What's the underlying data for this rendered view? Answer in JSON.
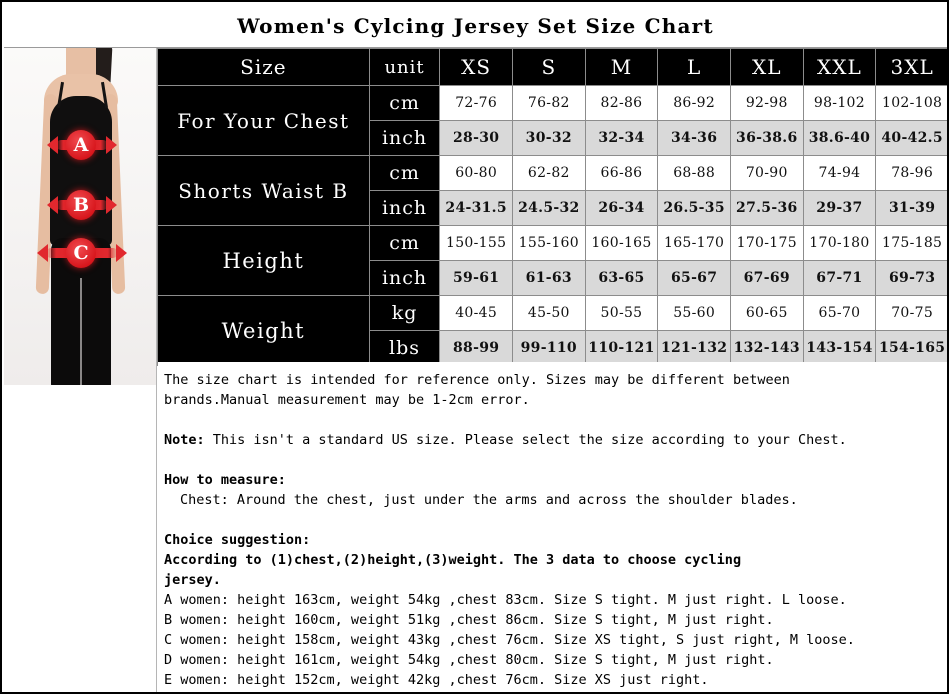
{
  "title": "Women's Cylcing Jersey Set Size Chart",
  "model_photo": {
    "alt": "woman wearing black camisole and leggings with measurement arrows",
    "markers": [
      {
        "id": "A",
        "meaning": "chest"
      },
      {
        "id": "B",
        "meaning": "waist"
      },
      {
        "id": "C",
        "meaning": "hips"
      }
    ]
  },
  "colors": {
    "header_bg": "#000000",
    "header_fg": "#ffffff",
    "row_alt_bg": "#d9d9d9",
    "row_bg": "#ffffff",
    "arrow_red": "#e1282e",
    "border": "#8c8c8c"
  },
  "table": {
    "corner_label": "Size",
    "unit_label": "unit",
    "sizes": [
      "XS",
      "S",
      "M",
      "L",
      "XL",
      "XXL",
      "3XL"
    ],
    "groups": [
      {
        "label": "For Your Chest",
        "rows": [
          {
            "unit": "cm",
            "shaded": false,
            "values": [
              "72-76",
              "76-82",
              "82-86",
              "86-92",
              "92-98",
              "98-102",
              "102-108"
            ]
          },
          {
            "unit": "inch",
            "shaded": true,
            "values": [
              "28-30",
              "30-32",
              "32-34",
              "34-36",
              "36-38.6",
              "38.6-40",
              "40-42.5"
            ]
          }
        ]
      },
      {
        "label": "Shorts Waist B",
        "rows": [
          {
            "unit": "cm",
            "shaded": false,
            "values": [
              "60-80",
              "62-82",
              "66-86",
              "68-88",
              "70-90",
              "74-94",
              "78-96"
            ]
          },
          {
            "unit": "inch",
            "shaded": true,
            "values": [
              "24-31.5",
              "24.5-32",
              "26-34",
              "26.5-35",
              "27.5-36",
              "29-37",
              "31-39"
            ]
          }
        ]
      },
      {
        "label": "Height",
        "rows": [
          {
            "unit": "cm",
            "shaded": false,
            "values": [
              "150-155",
              "155-160",
              "160-165",
              "165-170",
              "170-175",
              "170-180",
              "175-185"
            ]
          },
          {
            "unit": "inch",
            "shaded": true,
            "values": [
              "59-61",
              "61-63",
              "63-65",
              "65-67",
              "67-69",
              "67-71",
              "69-73"
            ]
          }
        ]
      },
      {
        "label": "Weight",
        "rows": [
          {
            "unit": "kg",
            "shaded": false,
            "values": [
              "40-45",
              "45-50",
              "50-55",
              "55-60",
              "60-65",
              "65-70",
              "70-75"
            ]
          },
          {
            "unit": "lbs",
            "shaded": true,
            "values": [
              "88-99",
              "99-110",
              "110-121",
              "121-132",
              "132-143",
              "143-154",
              "154-165"
            ]
          }
        ]
      }
    ]
  },
  "notes": {
    "disclaimer_line1": "The size chart is intended for reference only. Sizes may be different between",
    "disclaimer_line2": "brands.Manual measurement may be 1-2cm error.",
    "note_lead": "Note:",
    "note_text": " This isn't a standard US size. Please select the size according to your Chest.",
    "how_to_measure_heading": "How to measure:",
    "how_to_measure_item": "Chest: Around the chest, just under the arms and across the shoulder blades.",
    "choice_heading": "Choice suggestion:",
    "choice_line1": "According to (1)chest,(2)height,(3)weight. The 3 data to choose cycling",
    "choice_line2": "jersey.",
    "examples": [
      "A women: height 163cm, weight 54kg ,chest 83cm. Size S tight. M just right. L loose.",
      "B women: height 160cm, weight 51kg ,chest 86cm. Size S tight, M just right.",
      "C women: height 158cm, weight 43kg ,chest 76cm. Size XS tight, S just right, M loose.",
      "D women: height 161cm, weight 54kg ,chest 80cm. Size S tight, M just right.",
      "E women: height 152cm, weight 42kg ,chest 76cm. Size XS just right."
    ]
  }
}
